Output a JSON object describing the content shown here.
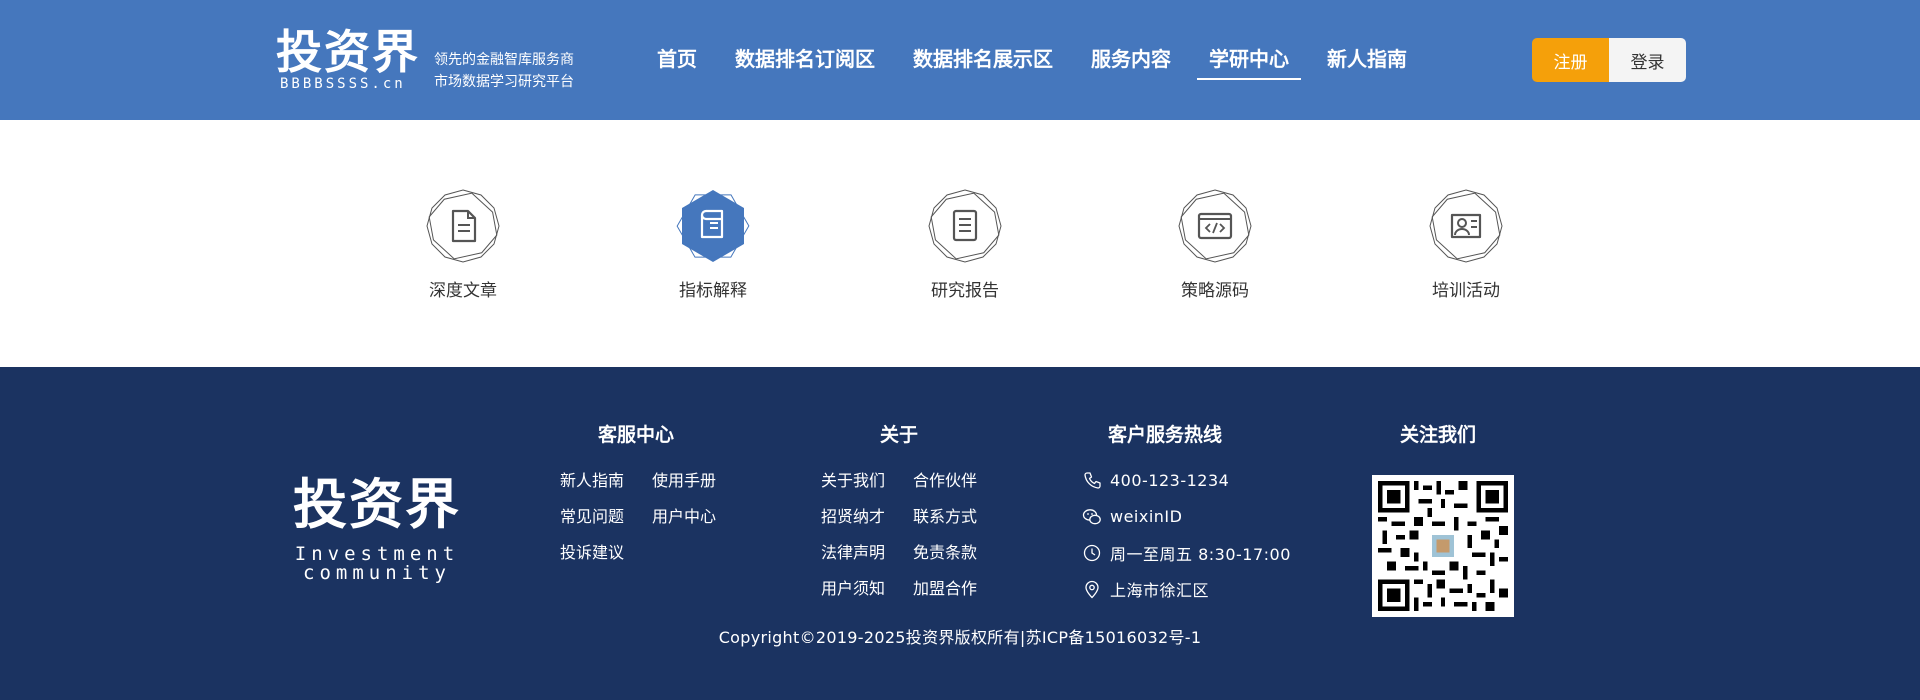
{
  "header": {
    "logo_title": "投资界",
    "logo_domain": "BBBBSSSS.cn",
    "tagline_line1": "领先的金融智库服务商",
    "tagline_line2": "市场数据学习研究平台",
    "nav": [
      {
        "label": "首页"
      },
      {
        "label": "数据排名订阅区"
      },
      {
        "label": "数据排名展示区"
      },
      {
        "label": "服务内容"
      },
      {
        "label": "学研中心",
        "active": true
      },
      {
        "label": "新人指南"
      }
    ],
    "register_label": "注册",
    "login_label": "登录",
    "colors": {
      "header_bg": "#4577bd",
      "register_bg": "#f5a00a"
    }
  },
  "categories": [
    {
      "label": "深度文章",
      "icon": "document-icon",
      "active": false
    },
    {
      "label": "指标解释",
      "icon": "book-icon",
      "active": true
    },
    {
      "label": "研究报告",
      "icon": "report-icon",
      "active": false
    },
    {
      "label": "策略源码",
      "icon": "code-icon",
      "active": false
    },
    {
      "label": "培训活动",
      "icon": "training-icon",
      "active": false
    }
  ],
  "footer": {
    "logo_title": "投资界",
    "logo_sub_line1": "Investment",
    "logo_sub_line2": "community",
    "service_center": {
      "title": "客服中心",
      "links": [
        "新人指南",
        "使用手册",
        "常见问题",
        "用户中心",
        "投诉建议"
      ]
    },
    "about": {
      "title": "关于",
      "links": [
        "关于我们",
        "合作伙伴",
        "招贤纳才",
        "联系方式",
        "法律声明",
        "免责条款",
        "用户须知",
        "加盟合作"
      ]
    },
    "hotline": {
      "title": "客户服务热线",
      "phone": "400-123-1234",
      "wechat": "weixinID",
      "hours": "周一至周五 8:30-17:00",
      "address": "上海市徐汇区"
    },
    "follow": {
      "title": "关注我们"
    },
    "copyright": "Copyright©2019-2025投资界版权所有|苏ICP备15016032号-1",
    "colors": {
      "footer_bg": "#1b3361"
    }
  }
}
